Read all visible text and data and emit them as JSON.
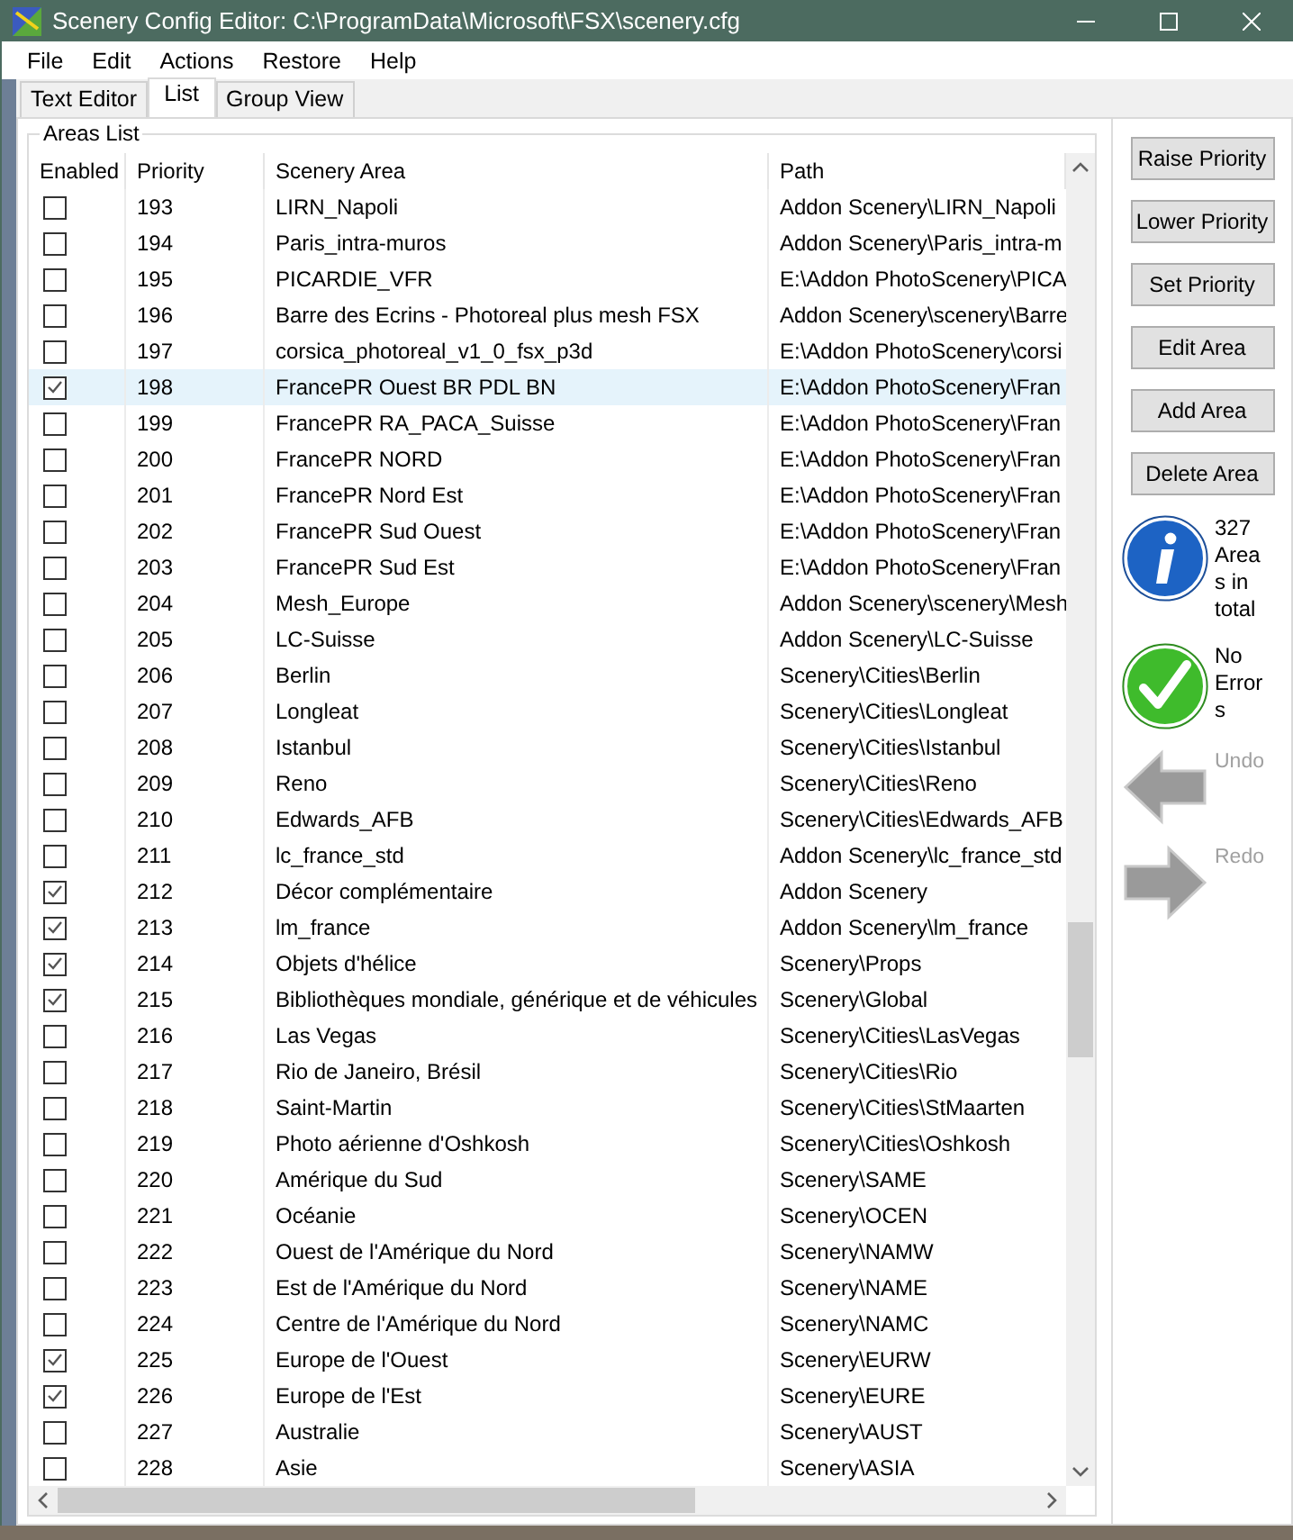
{
  "window": {
    "title": "Scenery Config Editor: C:\\ProgramData\\Microsoft\\FSX\\scenery.cfg"
  },
  "menu": [
    "File",
    "Edit",
    "Actions",
    "Restore",
    "Help"
  ],
  "tabs": [
    {
      "label": "Text Editor",
      "selected": false
    },
    {
      "label": "List",
      "selected": true
    },
    {
      "label": "Group View",
      "selected": false
    }
  ],
  "group": {
    "title": "Areas List"
  },
  "table": {
    "columns": [
      "Enabled",
      "Priority",
      "Scenery Area",
      "Path"
    ],
    "rows": [
      {
        "checked": false,
        "selected": false,
        "priority": "193",
        "area": "LIRN_Napoli",
        "path": "Addon Scenery\\LIRN_Napoli"
      },
      {
        "checked": false,
        "selected": false,
        "priority": "194",
        "area": "Paris_intra-muros",
        "path": "Addon Scenery\\Paris_intra-m"
      },
      {
        "checked": false,
        "selected": false,
        "priority": "195",
        "area": "PICARDIE_VFR",
        "path": "E:\\Addon PhotoScenery\\PICA"
      },
      {
        "checked": false,
        "selected": false,
        "priority": "196",
        "area": "Barre des Ecrins - Photoreal plus mesh FSX",
        "path": "Addon Scenery\\scenery\\Barre"
      },
      {
        "checked": false,
        "selected": false,
        "priority": "197",
        "area": "corsica_photoreal_v1_0_fsx_p3d",
        "path": "E:\\Addon PhotoScenery\\corsi"
      },
      {
        "checked": true,
        "selected": true,
        "priority": "198",
        "area": "FrancePR Ouest BR PDL BN",
        "path": "E:\\Addon PhotoScenery\\Fran"
      },
      {
        "checked": false,
        "selected": false,
        "priority": "199",
        "area": "FrancePR RA_PACA_Suisse",
        "path": "E:\\Addon PhotoScenery\\Fran"
      },
      {
        "checked": false,
        "selected": false,
        "priority": "200",
        "area": "FrancePR NORD",
        "path": "E:\\Addon PhotoScenery\\Fran"
      },
      {
        "checked": false,
        "selected": false,
        "priority": "201",
        "area": "FrancePR Nord Est",
        "path": "E:\\Addon PhotoScenery\\Fran"
      },
      {
        "checked": false,
        "selected": false,
        "priority": "202",
        "area": "FrancePR Sud Ouest",
        "path": "E:\\Addon PhotoScenery\\Fran"
      },
      {
        "checked": false,
        "selected": false,
        "priority": "203",
        "area": "FrancePR Sud Est",
        "path": "E:\\Addon PhotoScenery\\Fran"
      },
      {
        "checked": false,
        "selected": false,
        "priority": "204",
        "area": "Mesh_Europe",
        "path": "Addon Scenery\\scenery\\Mesh"
      },
      {
        "checked": false,
        "selected": false,
        "priority": "205",
        "area": "LC-Suisse",
        "path": "Addon Scenery\\LC-Suisse"
      },
      {
        "checked": false,
        "selected": false,
        "priority": "206",
        "area": "Berlin",
        "path": "Scenery\\Cities\\Berlin"
      },
      {
        "checked": false,
        "selected": false,
        "priority": "207",
        "area": "Longleat",
        "path": "Scenery\\Cities\\Longleat"
      },
      {
        "checked": false,
        "selected": false,
        "priority": "208",
        "area": "Istanbul",
        "path": "Scenery\\Cities\\Istanbul"
      },
      {
        "checked": false,
        "selected": false,
        "priority": "209",
        "area": "Reno",
        "path": "Scenery\\Cities\\Reno"
      },
      {
        "checked": false,
        "selected": false,
        "priority": "210",
        "area": "Edwards_AFB",
        "path": "Scenery\\Cities\\Edwards_AFB"
      },
      {
        "checked": false,
        "selected": false,
        "priority": "211",
        "area": "lc_france_std",
        "path": "Addon Scenery\\lc_france_std"
      },
      {
        "checked": true,
        "selected": false,
        "priority": "212",
        "area": "Décor complémentaire",
        "path": "Addon Scenery"
      },
      {
        "checked": true,
        "selected": false,
        "priority": "213",
        "area": "lm_france",
        "path": "Addon Scenery\\lm_france"
      },
      {
        "checked": true,
        "selected": false,
        "priority": "214",
        "area": "Objets d'hélice",
        "path": "Scenery\\Props"
      },
      {
        "checked": true,
        "selected": false,
        "priority": "215",
        "area": "Bibliothèques mondiale, générique et de véhicules",
        "path": "Scenery\\Global"
      },
      {
        "checked": false,
        "selected": false,
        "priority": "216",
        "area": "Las Vegas",
        "path": "Scenery\\Cities\\LasVegas"
      },
      {
        "checked": false,
        "selected": false,
        "priority": "217",
        "area": "Rio de Janeiro, Brésil",
        "path": "Scenery\\Cities\\Rio"
      },
      {
        "checked": false,
        "selected": false,
        "priority": "218",
        "area": "Saint-Martin",
        "path": "Scenery\\Cities\\StMaarten"
      },
      {
        "checked": false,
        "selected": false,
        "priority": "219",
        "area": "Photo aérienne d'Oshkosh",
        "path": "Scenery\\Cities\\Oshkosh"
      },
      {
        "checked": false,
        "selected": false,
        "priority": "220",
        "area": "Amérique du Sud",
        "path": "Scenery\\SAME"
      },
      {
        "checked": false,
        "selected": false,
        "priority": "221",
        "area": "Océanie",
        "path": "Scenery\\OCEN"
      },
      {
        "checked": false,
        "selected": false,
        "priority": "222",
        "area": "Ouest de l'Amérique du Nord",
        "path": "Scenery\\NAMW"
      },
      {
        "checked": false,
        "selected": false,
        "priority": "223",
        "area": "Est de l'Amérique du Nord",
        "path": "Scenery\\NAME"
      },
      {
        "checked": false,
        "selected": false,
        "priority": "224",
        "area": "Centre de l'Amérique du Nord",
        "path": "Scenery\\NAMC"
      },
      {
        "checked": true,
        "selected": false,
        "priority": "225",
        "area": "Europe de l'Ouest",
        "path": "Scenery\\EURW"
      },
      {
        "checked": true,
        "selected": false,
        "priority": "226",
        "area": "Europe de l'Est",
        "path": "Scenery\\EURE"
      },
      {
        "checked": false,
        "selected": false,
        "priority": "227",
        "area": "Australie",
        "path": "Scenery\\AUST"
      },
      {
        "checked": false,
        "selected": false,
        "priority": "228",
        "area": "Asie",
        "path": "Scenery\\ASIA"
      }
    ]
  },
  "buttons": [
    "Raise Priority",
    "Lower Priority",
    "Set Priority",
    "Edit Area",
    "Add Area",
    "Delete Area"
  ],
  "status": [
    {
      "kind": "info",
      "text": "327 Areas in total"
    },
    {
      "kind": "ok",
      "text": "No Errors"
    }
  ],
  "history": [
    {
      "kind": "undo",
      "label": "Undo",
      "disabled": true
    },
    {
      "kind": "redo",
      "label": "Redo",
      "disabled": true
    }
  ]
}
